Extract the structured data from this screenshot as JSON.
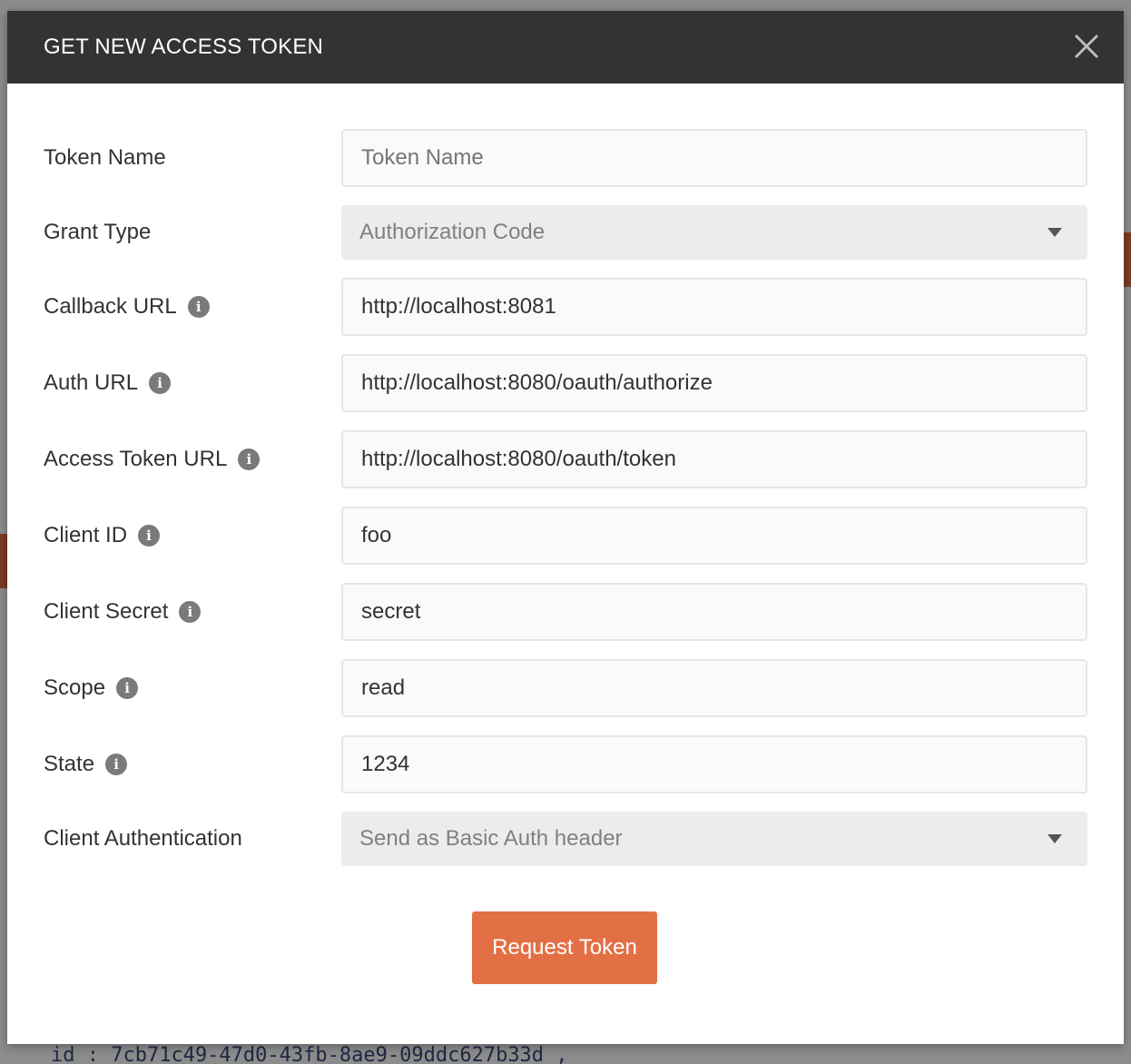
{
  "modal": {
    "title": "GET NEW ACCESS TOKEN",
    "close_icon": "close-icon"
  },
  "form": {
    "token_name": {
      "label": "Token Name",
      "value": "",
      "placeholder": "Token Name"
    },
    "grant_type": {
      "label": "Grant Type",
      "value": "Authorization Code"
    },
    "callback_url": {
      "label": "Callback URL",
      "value": "http://localhost:8081"
    },
    "auth_url": {
      "label": "Auth URL",
      "value": "http://localhost:8080/oauth/authorize"
    },
    "access_token_url": {
      "label": "Access Token URL",
      "value": "http://localhost:8080/oauth/token"
    },
    "client_id": {
      "label": "Client ID",
      "value": "foo"
    },
    "client_secret": {
      "label": "Client Secret",
      "value": "secret"
    },
    "scope": {
      "label": "Scope",
      "value": "read"
    },
    "state": {
      "label": "State",
      "value": "1234"
    },
    "client_authentication": {
      "label": "Client Authentication",
      "value": "Send as Basic Auth header"
    }
  },
  "request_button": {
    "label": "Request Token"
  },
  "background": {
    "code_line": "id : 7cb71c49-47d0-43fb-8ae9-09ddc627b33d ,"
  },
  "colors": {
    "header_bg": "#333333",
    "accent": "#e37044",
    "info_icon": "#7a7a7a"
  }
}
